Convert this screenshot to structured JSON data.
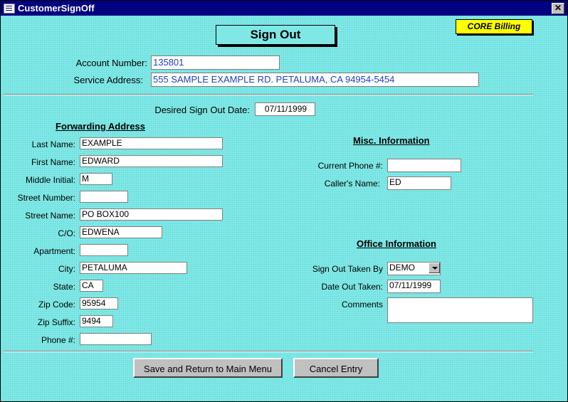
{
  "window": {
    "title": "CustomerSignOff",
    "close_glyph": "✕"
  },
  "header": {
    "title": "Sign Out",
    "badge": "CORE Billing"
  },
  "account": {
    "account_number_label": "Account Number:",
    "account_number": "135801",
    "service_address_label": "Service Address:",
    "service_address": "555 SAMPLE EXAMPLE RD. PETALUMA, CA  94954-5454"
  },
  "sign_out_date": {
    "label": "Desired Sign Out Date:",
    "value": "07/11/1999"
  },
  "forwarding": {
    "heading": "Forwarding Address",
    "fields": {
      "last_name": {
        "label": "Last Name:",
        "value": "EXAMPLE"
      },
      "first_name": {
        "label": "First Name:",
        "value": "EDWARD"
      },
      "middle_initial": {
        "label": "Middle Initial:",
        "value": "M"
      },
      "street_number": {
        "label": "Street Number:",
        "value": ""
      },
      "street_name": {
        "label": "Street Name:",
        "value": "PO BOX100"
      },
      "co": {
        "label": "C/O:",
        "value": "EDWENA"
      },
      "apartment": {
        "label": "Apartment:",
        "value": ""
      },
      "city": {
        "label": "City:",
        "value": "PETALUMA"
      },
      "state": {
        "label": "State:",
        "value": "CA"
      },
      "zip_code": {
        "label": "Zip Code:",
        "value": "95954"
      },
      "zip_suffix": {
        "label": "Zip Suffix:",
        "value": "9494"
      },
      "phone": {
        "label": "Phone #:",
        "value": ""
      }
    }
  },
  "misc": {
    "heading": "Misc. Information",
    "current_phone": {
      "label": "Current Phone #:",
      "value": ""
    },
    "callers_name": {
      "label": "Caller's Name:",
      "value": "ED"
    }
  },
  "office": {
    "heading": "Office Information",
    "taken_by": {
      "label": "Sign Out Taken By",
      "value": "DEMO"
    },
    "date_out": {
      "label": "Date Out Taken:",
      "value": "07/11/1999"
    },
    "comments": {
      "label": "Comments",
      "value": ""
    }
  },
  "buttons": {
    "save": "Save and Return to Main Menu",
    "cancel": "Cancel Entry"
  },
  "colors": {
    "background": "#7fe8e6",
    "titlebar": "#000080",
    "badge": "#ffff00",
    "field_text_blue": "#2040c0"
  }
}
